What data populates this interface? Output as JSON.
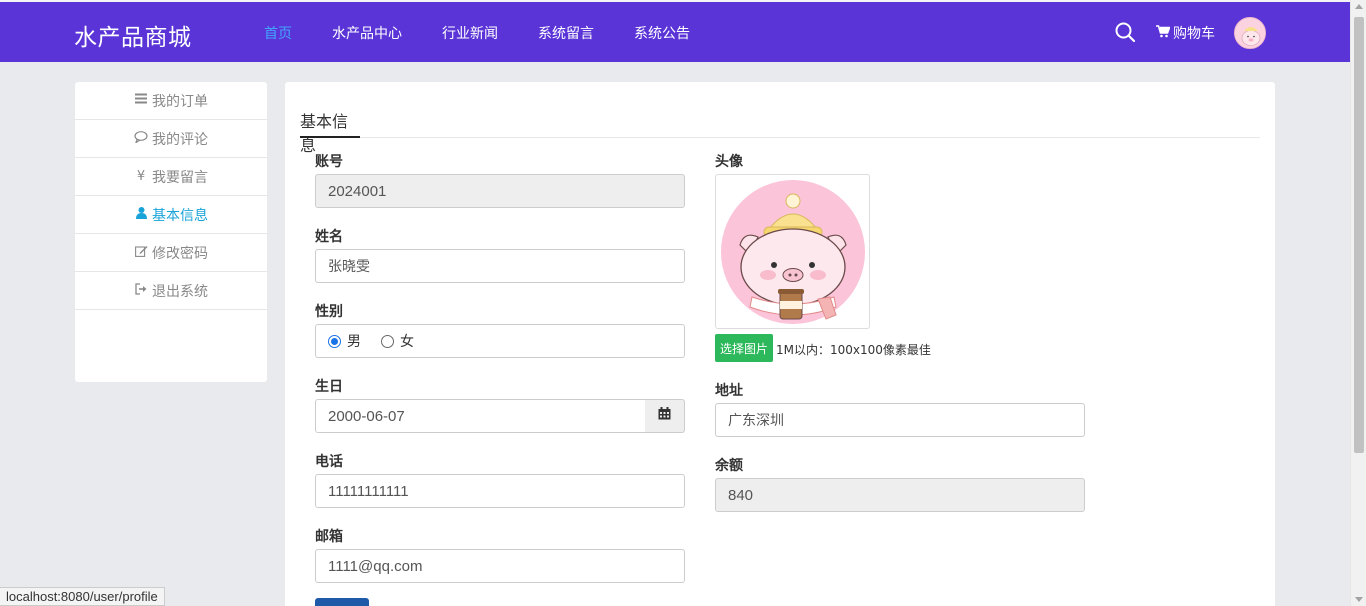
{
  "header": {
    "brand": "水产品商城",
    "nav": [
      "首页",
      "水产品中心",
      "行业新闻",
      "系统留言",
      "系统公告"
    ],
    "cart_label": "购物车",
    "accent_color": "#5a34d6",
    "active_nav_color": "#42a5ff"
  },
  "sidebar": {
    "items": [
      {
        "icon": "list-icon",
        "label": "我的订单"
      },
      {
        "icon": "comment-icon",
        "label": "我的评论"
      },
      {
        "icon": "yen-icon",
        "label": "我要留言"
      },
      {
        "icon": "user-icon",
        "label": "基本信息"
      },
      {
        "icon": "edit-icon",
        "label": "修改密码"
      },
      {
        "icon": "sign-out-icon",
        "label": "退出系统"
      }
    ],
    "active_color": "#1aa3d9"
  },
  "form": {
    "tab": "基本信息",
    "account": {
      "label": "账号",
      "value": "2024001"
    },
    "name": {
      "label": "姓名",
      "value": "张晓雯"
    },
    "gender": {
      "label": "性别",
      "options": [
        "男",
        "女"
      ],
      "selected": "男"
    },
    "birthday": {
      "label": "生日",
      "value": "2000-06-07"
    },
    "phone": {
      "label": "电话",
      "value": "11111111111"
    },
    "email": {
      "label": "邮箱",
      "value": "1111@qq.com"
    },
    "avatar": {
      "label": "头像",
      "upload_button": "选择图片",
      "hint": "1M以内：100x100像素最佳"
    },
    "address": {
      "label": "地址",
      "value": "广东深圳"
    },
    "balance": {
      "label": "余额",
      "value": "840"
    },
    "upload_color": "#2eb85c"
  },
  "status_bar": {
    "url": "localhost:8080/user/profile"
  }
}
